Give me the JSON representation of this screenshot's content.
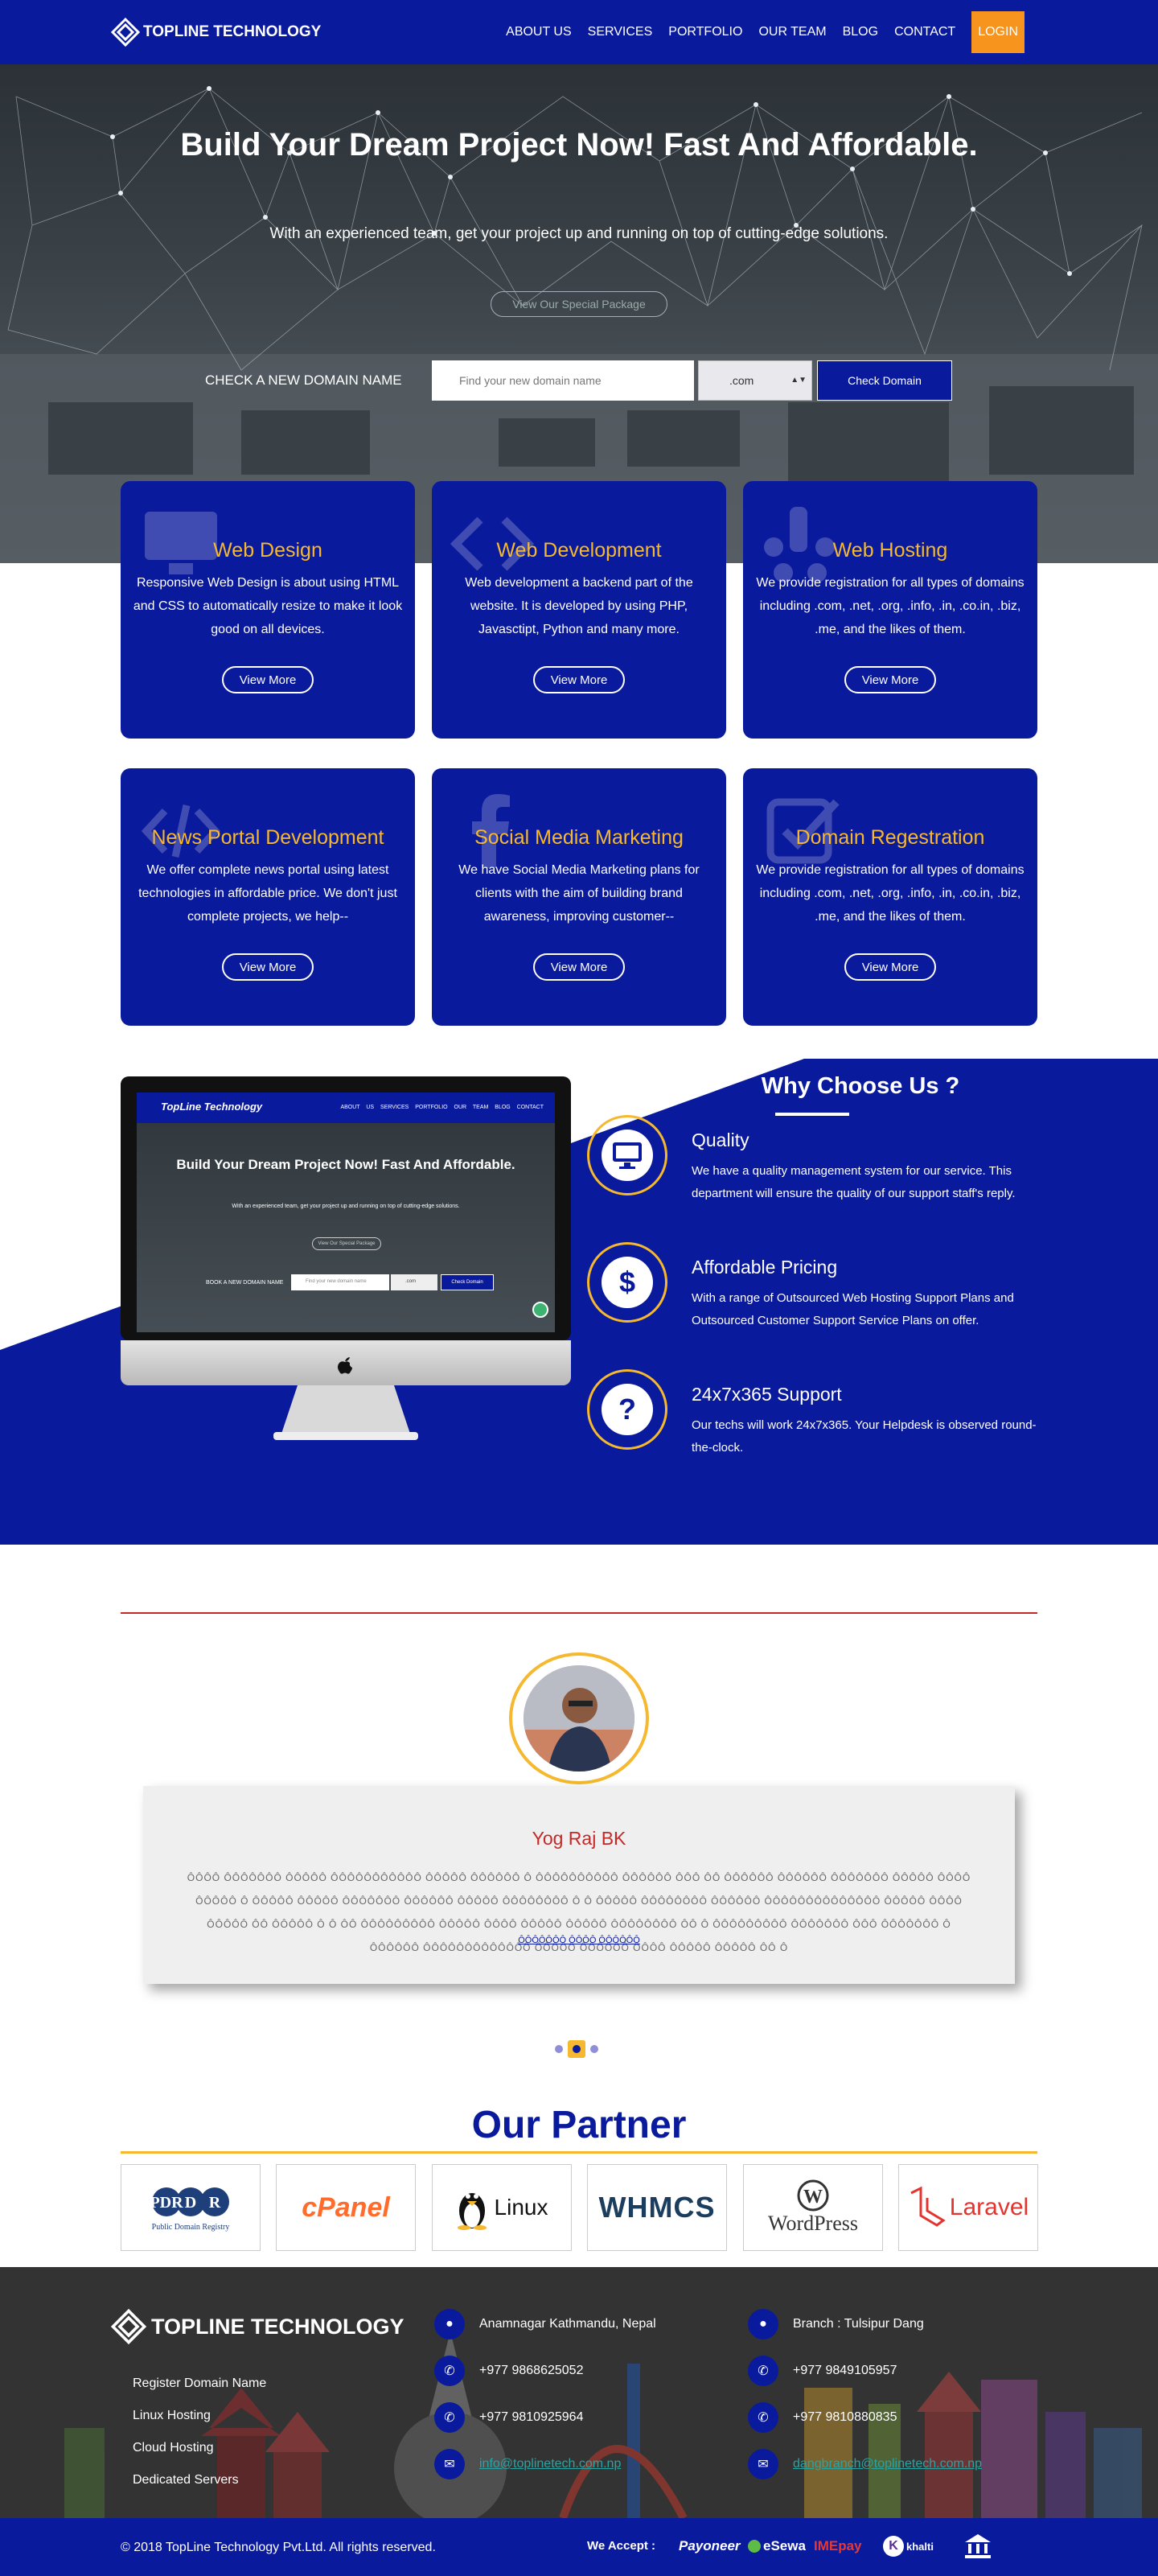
{
  "nav": {
    "brand": "TOPLINE TECHNOLOGY",
    "links": [
      "ABOUT US",
      "SERVICES",
      "PORTFOLIO",
      "OUR TEAM",
      "BLOG",
      "CONTACT"
    ],
    "login": "LOGIN"
  },
  "hero": {
    "title": "Build Your Dream Project Now! Fast And Affordable.",
    "subtitle": "With an experienced team, get your project up and running on top of cutting-edge solutions.",
    "package_button": "View Our Special Package",
    "domain_label": "CHECK A NEW DOMAIN NAME",
    "domain_placeholder": "Find your new domain name",
    "domain_extension": ".com",
    "domain_button": "Check Domain"
  },
  "services": [
    {
      "title": "Web Design",
      "icon": "monitor-icon",
      "desc": "Responsive Web Design is about using HTML and CSS to automatically resize to make it look good on all devices.",
      "button": "View More"
    },
    {
      "title": "Web Development",
      "icon": "code-icon",
      "desc": "Web development a backend part of the website. It is developed by using PHP, Javasctipt, Python and many more.",
      "button": "View More"
    },
    {
      "title": "Web Hosting",
      "icon": "yelp-icon",
      "desc": "We provide registration for all types of domains including .com, .net, .org, .info, .in, .co.in, .biz, .me, and the likes of them.",
      "button": "View More"
    },
    {
      "title": "News Portal Development",
      "icon": "code-brackets-icon",
      "desc": "We offer complete news portal using latest technologies in affordable price. We don't just complete projects, we help--",
      "button": "View More"
    },
    {
      "title": "Social Media Marketing",
      "icon": "facebook-icon",
      "desc": "We have Social Media Marketing plans for clients with the aim of building brand awareness, improving customer--",
      "button": "View More"
    },
    {
      "title": "Domain Regestration",
      "icon": "checkbox-icon",
      "desc": "We provide registration for all types of domains including .com, .net, .org, .info, .in, .co.in, .biz, .me, and the likes of them.",
      "button": "View More"
    }
  ],
  "mockup": {
    "brand": "TopLine Technology",
    "links": "ABOUT US SERVICES PORTFOLIO OUR TEAM BLOG CONTACT",
    "title": "Build Your Dream Project Now! Fast And Affordable.",
    "subtitle": "With an experienced team, get your project up and running on top of cutting-edge solutions.",
    "package": "View Our Special Package",
    "domain_label": "BOOK A NEW DOMAIN NAME",
    "placeholder": "Find your new domain name",
    "ext": ".com",
    "button": "Check Domain"
  },
  "why": {
    "title": "Why Choose Us ?",
    "features": [
      {
        "icon": "monitor-icon",
        "title": "Quality",
        "desc": "We have a quality management system for our service. This department will ensure the quality of our support staff's reply."
      },
      {
        "icon": "dollar-icon",
        "title": "Affordable Pricing",
        "desc": "With a range of Outsourced Web Hosting Support Plans and Outsourced Customer Support Service Plans on offer."
      },
      {
        "icon": "question-icon",
        "title": "24x7x365 Support",
        "desc": "Our techs will work 24x7x365. Your Helpdesk is observed round-the-clock."
      }
    ]
  },
  "testimonial": {
    "name": "Yog Raj BK",
    "text": "ÔÔÔÔ ÔÔÔÔÔÔÔ ÔÔÔÔÔ ÔÔÔÔÔÔÔÔÔÔÔ ÔÔÔÔÔ ÔÔÔÔÔÔ Ô ÔÔÔÔÔÔÔÔÔÔ ÔÔÔÔÔÔ ÔÔÔ ÔÔ ÔÔÔÔÔÔ ÔÔÔÔÔÔ ÔÔÔÔÔÔÔ ÔÔÔÔÔ ÔÔÔÔ ÔÔÔÔÔ Ô ÔÔÔÔÔ ÔÔÔÔÔ ÔÔÔÔÔÔÔ ÔÔÔÔÔÔ ÔÔÔÔÔ ÔÔÔÔÔÔÔÔ Ô Ô ÔÔÔÔÔ ÔÔÔÔÔÔÔÔ ÔÔÔÔÔÔ ÔÔÔÔÔÔÔÔÔÔÔÔÔÔ ÔÔÔÔÔ ÔÔÔÔ ÔÔÔÔÔ ÔÔ ÔÔÔÔÔ Ô Ô ÔÔ ÔÔÔÔÔÔÔÔÔ ÔÔÔÔÔ ÔÔÔÔ ÔÔÔÔÔ ÔÔÔÔÔ ÔÔÔÔÔÔÔÔ ÔÔ Ô ÔÔÔÔÔÔÔÔÔ ÔÔÔÔÔÔÔ ÔÔÔ ÔÔÔÔÔÔÔ Ô ÔÔÔÔÔÔ ÔÔÔÔÔÔÔÔÔÔÔÔÔ ÔÔÔÔÔ ÔÔÔÔÔÔ ÔÔÔÔ ÔÔÔÔÔ ÔÔÔÔÔ ÔÔ Ô",
    "link": "ÔÔÔÔÔÔÔ ÔÔÔÔ ÔÔÔÔÔÔ",
    "slides_active": 1
  },
  "partners": {
    "title": "Our Partner",
    "logos": [
      "PDR",
      "Public Domain Registry",
      "cPanel",
      "Linux",
      "WHMCS",
      "WordPress",
      "Laravel"
    ]
  },
  "footer": {
    "brand": "TOPLINE TECHNOLOGY",
    "links": [
      "Register Domain Name",
      "Linux Hosting",
      "Cloud Hosting",
      "Dedicated Servers"
    ],
    "col1": {
      "address": "Anamnagar Kathmandu, Nepal",
      "phone1": "+977 9868625052",
      "phone2": "+977 9810925964",
      "email": "info@toplinetech.com.np"
    },
    "col2": {
      "address": "Branch : Tulsipur Dang",
      "phone1": "+977 9849105957",
      "phone2": "+977 9810880835",
      "email": "dangbranch@toplinetech.com.np"
    }
  },
  "bottom": {
    "copyright": "© 2018 TopLine Technology Pvt.Ltd. All rights reserved.",
    "accept": "We Accept :",
    "payments": [
      "Payoneer",
      "eSewa",
      "IMEpay",
      "khalti",
      "bank"
    ]
  },
  "colors": {
    "primary": "#0a1a9c",
    "accent": "#f5b82e",
    "login": "#f7941d",
    "name_red": "#c62828"
  }
}
